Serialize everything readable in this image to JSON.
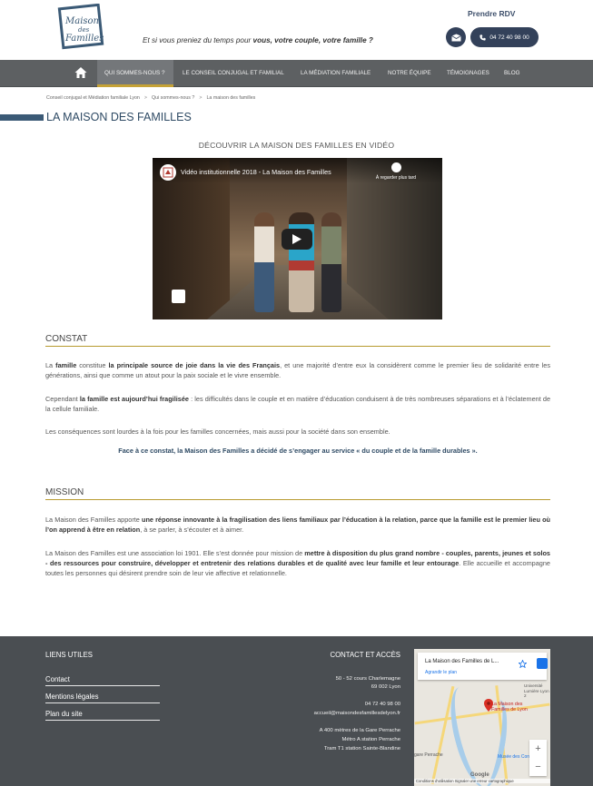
{
  "header": {
    "logo_text_1": "Maison",
    "logo_text_2": "des",
    "logo_text_3": "Familles",
    "tagline_plain": "Et si vous preniez du temps pour ",
    "tagline_bold": "vous, votre couple, votre famille ?",
    "rdv_label": "Prendre RDV",
    "phone": "04 72 40 98 00"
  },
  "nav": {
    "items": [
      {
        "label": "Qui sommes-nous ?",
        "active": true
      },
      {
        "label": "Le conseil conjugal et familial"
      },
      {
        "label": "La médiation familiale"
      },
      {
        "label": "Notre équipe"
      },
      {
        "label": "Témoignages"
      },
      {
        "label": "Blog"
      }
    ]
  },
  "breadcrumb": {
    "items": [
      "Conseil conjugal et Médiation familiale Lyon",
      "Qui sommes-nous ?",
      "La maison des familles"
    ],
    "separator": ">"
  },
  "page": {
    "title": "LA MAISON DES FAMILLES",
    "video_heading": "Découvrir la Maison des Familles en vidéo",
    "video_title": "Vidéo institutionnelle 2018 - La Maison des Familles",
    "video_watch_later": "À regarder plus tard"
  },
  "constat": {
    "heading": "Constat",
    "p1_a": "La ",
    "p1_b": "famille",
    "p1_c": " constitue ",
    "p1_d": "la principale source de joie dans la vie des Français",
    "p1_e": ", et une majorité d’entre eux la considèrent comme le premier lieu de solidarité entre les générations, ainsi que comme un atout pour la paix sociale et le vivre ensemble.",
    "p2_a": "Cependant ",
    "p2_b": "la famille est aujourd’hui fragilisée",
    "p2_c": " : les difficultés dans le couple et en matière d’éducation conduisent à de très nombreuses séparations et à l’éclatement de la cellule familiale.",
    "p3": "Les conséquences sont lourdes à la fois pour les familles concernées, mais aussi pour la société dans son ensemble.",
    "p4": "Face à ce constat, la Maison des Familles a décidé de s’engager au service « du couple et de la famille durables »."
  },
  "mission": {
    "heading": "Mission",
    "p1_a": "La Maison des Familles apporte ",
    "p1_b": "une réponse innovante à la fragilisation des liens familiaux par l’éducation à la relation, parce que la famille est le premier lieu où l’on apprend à être en relation",
    "p1_c": ", à se parler, à s’écouter et à aimer.",
    "p2_a": "La Maison des Familles est une association loi 1901. Elle s’est donnée pour mission de ",
    "p2_b": "mettre à disposition du plus grand nombre - couples, parents, jeunes et solos - des ressources pour construire, développer et entretenir des relations durables et de qualité avec leur famille et leur entourage",
    "p2_c": ". Elle accueille et accompagne toutes les personnes qui désirent prendre soin de leur vie affective et relationnelle."
  },
  "footer": {
    "links_heading": "Liens utiles",
    "links": [
      "Contact",
      "Mentions légales",
      "Plan du site"
    ],
    "contact_heading": "Contact et accès",
    "address_1": "50 - 52 cours Charlemagne",
    "address_2": "69 002 Lyon",
    "phone": "04 72 40 98 00",
    "email": "accueil@maisondesfamillesdelyon.fr",
    "access_1": "A 400 mètres de la Gare Perrache",
    "access_2": "Métro A station Perrache",
    "access_3": "Tram T1 station Sainte-Blandine",
    "map": {
      "place_title": "La Maison des Familles de L...",
      "enlarge": "Agrandir le plan",
      "pin_label_1": "La Maison des",
      "pin_label_2": "Familles de Lyon",
      "place_lumiere_1": "Université",
      "place_lumiere_2": "Lumière Lyon 2",
      "place_museum": "Musée des Confluen",
      "place_gare": "gare Perrache",
      "google": "Google",
      "terms": "Conditions d'utilisation   Signaler une erreur cartographique"
    }
  }
}
